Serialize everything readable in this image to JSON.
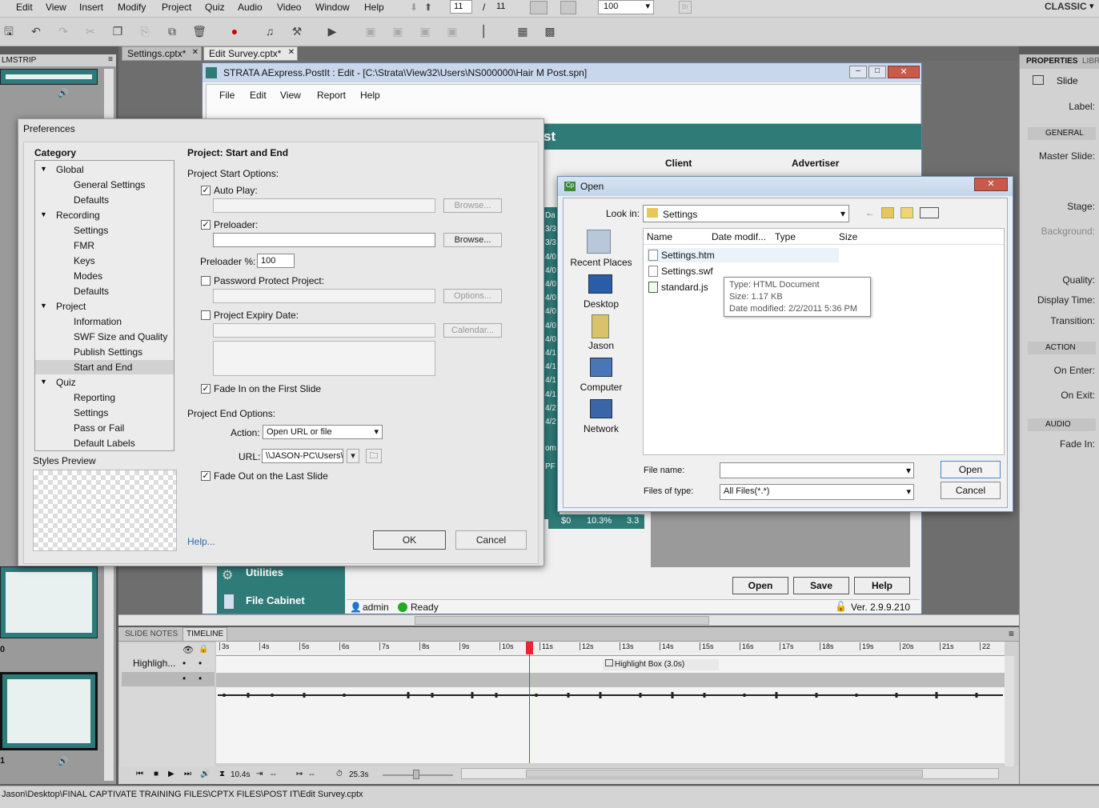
{
  "menu": [
    "Edit",
    "View",
    "Insert",
    "Modify",
    "Project",
    "Quiz",
    "Audio",
    "Video",
    "Window",
    "Help"
  ],
  "slide_nav": {
    "current": "11",
    "sep": "/",
    "total": "11"
  },
  "zoom": "100",
  "br_label": "Br",
  "workspace": "CLASSIC",
  "tabs": [
    {
      "label": "Settings.cptx*"
    },
    {
      "label": "Edit Survey.cptx*"
    }
  ],
  "tab_close": "✕",
  "filmstrip": {
    "title": "LMSTRIP",
    "labels": [
      "0",
      "1"
    ]
  },
  "properties": {
    "tab": "PROPERTIES",
    "tab2": "LIBR",
    "slide": "Slide",
    "label": "Label:",
    "general": "GENERAL",
    "master": "Master Slide:",
    "stage": "Stage:",
    "background": "Background:",
    "quality": "Quality:",
    "display_time": "Display Time:",
    "transition": "Transition:",
    "action": "ACTION",
    "on_enter": "On Enter:",
    "on_exit": "On Exit:",
    "audio": "AUDIO",
    "fade_in": "Fade In:"
  },
  "strata": {
    "title": "STRATA AExpress.PostIt : Edit - [C:\\Strata\\View32\\Users\\NS000000\\Hair M Post.spn]",
    "menu": [
      "File",
      "Edit",
      "View",
      "Report",
      "Help"
    ],
    "banner": "st",
    "client": "Client",
    "advertiser": "Advertiser",
    "row_frag": [
      "Da",
      "3/3",
      "3/3",
      "4/0",
      "4/0",
      "4/0",
      "4/0",
      "4/0",
      "4/0",
      "4/0",
      "4/1",
      "4/1",
      "4/1",
      "4/1",
      "4/2",
      "4/2"
    ],
    "totals": [
      "$0",
      "10.3%",
      "3.3"
    ],
    "side_frag": [
      "om",
      "PF"
    ],
    "utilities": "Utilities",
    "file_cabinet": "File Cabinet",
    "btn_open": "Open",
    "btn_save": "Save",
    "btn_help": "Help",
    "user": "admin",
    "status": "Ready",
    "version": "Ver. 2.9.9.210"
  },
  "preferences": {
    "title": "Preferences",
    "category": "Category",
    "tree": [
      {
        "label": "Global",
        "level": 0
      },
      {
        "label": "General Settings",
        "level": 1
      },
      {
        "label": "Defaults",
        "level": 1
      },
      {
        "label": "Recording",
        "level": 0
      },
      {
        "label": "Settings",
        "level": 1
      },
      {
        "label": "FMR",
        "level": 1
      },
      {
        "label": "Keys",
        "level": 1
      },
      {
        "label": "Modes",
        "level": 1
      },
      {
        "label": "Defaults",
        "level": 1
      },
      {
        "label": "Project",
        "level": 0
      },
      {
        "label": "Information",
        "level": 1
      },
      {
        "label": "SWF Size and Quality",
        "level": 1
      },
      {
        "label": "Publish Settings",
        "level": 1
      },
      {
        "label": "Start and End",
        "level": 1,
        "selected": true
      },
      {
        "label": "Quiz",
        "level": 0
      },
      {
        "label": "Reporting",
        "level": 1
      },
      {
        "label": "Settings",
        "level": 1
      },
      {
        "label": "Pass or Fail",
        "level": 1
      },
      {
        "label": "Default Labels",
        "level": 1
      }
    ],
    "styles_preview": "Styles Preview",
    "heading": "Project: Start and End",
    "start_options": "Project Start Options:",
    "auto_play": "Auto Play:",
    "browse": "Browse...",
    "preloader": "Preloader:",
    "preloader_pct_label": "Preloader %:",
    "preloader_pct": "100",
    "password": "Password Protect Project:",
    "options": "Options...",
    "expiry": "Project Expiry Date:",
    "calendar": "Calendar...",
    "fade_in": "Fade In on the First Slide",
    "end_options": "Project End Options:",
    "action_label": "Action:",
    "action_value": "Open URL or file",
    "url_label": "URL:",
    "url_value": "\\\\JASON-PC\\Users\\",
    "fade_out": "Fade Out on the Last Slide",
    "help": "Help...",
    "ok": "OK",
    "cancel": "Cancel"
  },
  "open_dialog": {
    "title": "Open",
    "look_in": "Look in:",
    "folder": "Settings",
    "places": [
      "Recent Places",
      "Desktop",
      "Jason",
      "Computer",
      "Network"
    ],
    "columns": [
      "Name",
      "Date modif...",
      "Type",
      "Size"
    ],
    "files": [
      "Settings.htm",
      "Settings.swf",
      "standard.js"
    ],
    "tooltip": [
      "Type: HTML Document",
      "Size: 1.17 KB",
      "Date modified: 2/2/2011 5:36 PM"
    ],
    "file_name_label": "File name:",
    "file_name": "",
    "files_of_type_label": "Files of type:",
    "files_of_type": "All Files(*.*)",
    "open": "Open",
    "cancel": "Cancel"
  },
  "timeline": {
    "tab_notes": "SLIDE NOTES",
    "tab_timeline": "TIMELINE",
    "ticks": [
      "3s",
      "4s",
      "5s",
      "6s",
      "7s",
      "8s",
      "9s",
      "10s",
      "11s",
      "12s",
      "13s",
      "14s",
      "15s",
      "16s",
      "17s",
      "18s",
      "19s",
      "20s",
      "21s",
      "22"
    ],
    "layer1": "Highligh...",
    "highlight_box": "Highlight Box (3.0s)",
    "time1": "10.4s",
    "time2": "--",
    "time3": "--",
    "time4": "25.3s"
  },
  "status_path": "Jason\\Desktop\\FINAL CAPTIVATE TRAINING FILES\\CPTX FILES\\POST IT\\Edit Survey.cptx"
}
